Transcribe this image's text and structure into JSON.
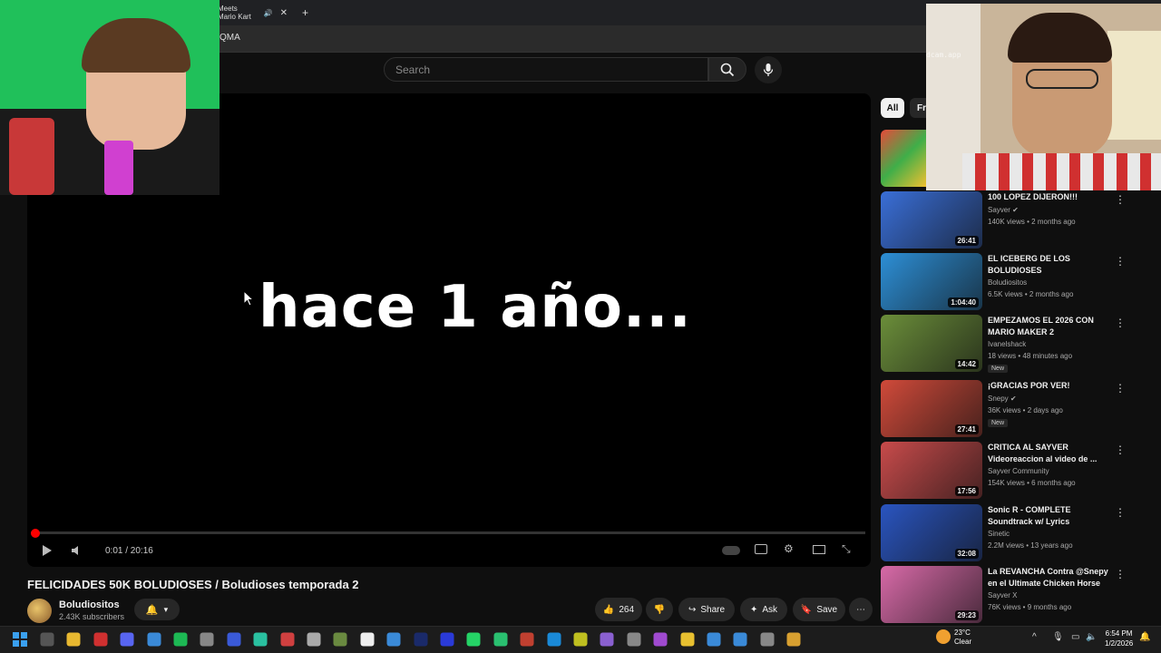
{
  "browser": {
    "tab_title": "Meets Mario Kart",
    "url_fragment": "QMA"
  },
  "header": {
    "search_placeholder": "Search"
  },
  "player": {
    "overlay_text": "hace 1 año...",
    "time": "0:01 / 20:16",
    "progress": 0.0008
  },
  "video": {
    "title": "FELICIDADES 50K BOLUDIOSES / Boludioses temporada 2",
    "channel": "Boludiositos",
    "subscribers": "2.43K subscribers",
    "likes": "264",
    "share_label": "Share",
    "ask_label": "Ask",
    "save_label": "Save"
  },
  "sidebar": {
    "chips": [
      "All",
      "Fr"
    ],
    "recommendations": [
      {
        "title": "100 LOPEZ DIJERON!!!",
        "channel": "Sayver",
        "verified": true,
        "meta": "140K views • 2 months ago",
        "duration": "26:41",
        "new": false,
        "color": "#3a6fd8"
      },
      {
        "title": "EL ICEBERG DE LOS BOLUDIOSES",
        "channel": "Boludiositos",
        "verified": false,
        "meta": "6.5K views • 2 months ago",
        "duration": "1:04:40",
        "new": false,
        "color": "#2d8fd6"
      },
      {
        "title": "EMPEZAMOS EL 2026 CON MARIO MAKER 2",
        "channel": "Ivanelshack",
        "verified": false,
        "meta": "18 views • 48 minutes ago",
        "duration": "14:42",
        "new": true,
        "color": "#6b8e3a"
      },
      {
        "title": "¡GRACIAS POR VER!",
        "channel": "Snepy",
        "verified": true,
        "meta": "36K views • 2 days ago",
        "duration": "27:41",
        "new": true,
        "color": "#d04a3a"
      },
      {
        "title": "CRITICA AL SAYVER Videoreaccion al video de ...",
        "channel": "Sayver Community",
        "verified": false,
        "meta": "154K views • 6 months ago",
        "duration": "17:56",
        "new": false,
        "color": "#c84b4b"
      },
      {
        "title": "Sonic R - COMPLETE Soundtrack w/ Lyrics",
        "channel": "Sinetic",
        "verified": false,
        "meta": "2.2M views • 13 years ago",
        "duration": "32:08",
        "new": false,
        "color": "#2a55c0"
      },
      {
        "title": "La REVANCHA Contra @Snepy en el Ultimate Chicken Horse",
        "channel": "Sayver X",
        "verified": false,
        "meta": "76K views • 9 months ago",
        "duration": "29:23",
        "new": false,
        "color": "#d86aa8"
      }
    ]
  },
  "taskbar": {
    "weather_temp": "23°C",
    "weather_desc": "Clear",
    "time": "6:54 PM",
    "date": "1/2/2026"
  },
  "webcam_right": {
    "watermark": "dcam.app"
  }
}
